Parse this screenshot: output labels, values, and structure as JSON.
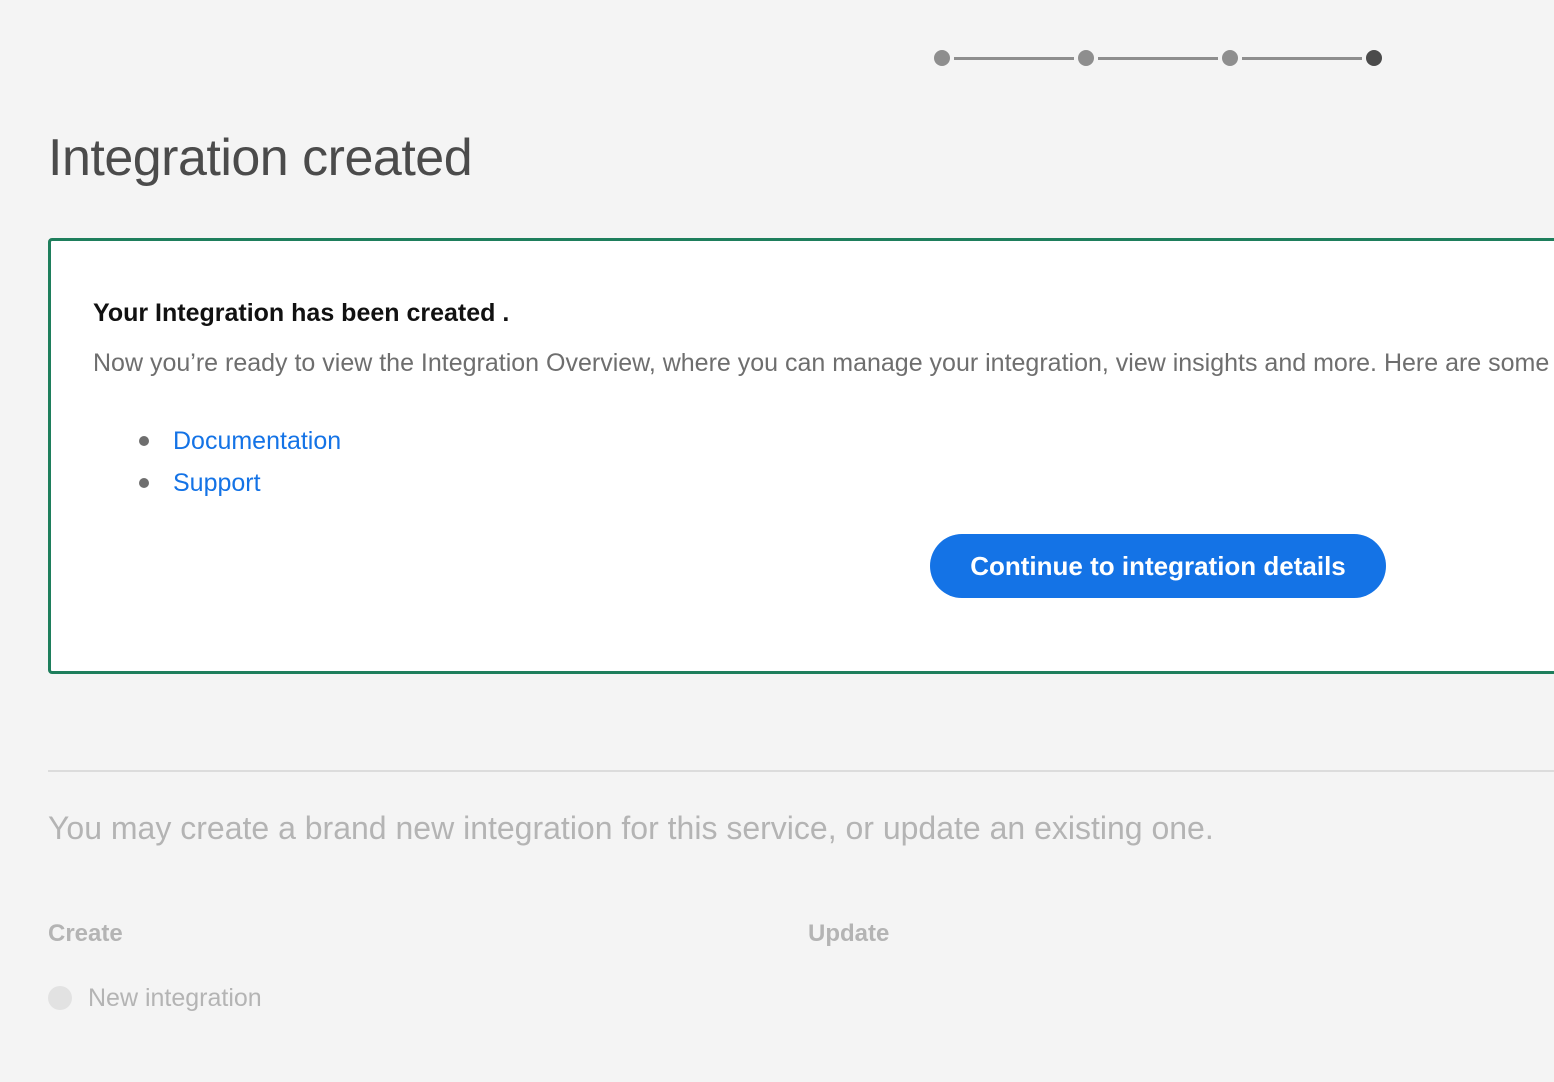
{
  "stepper": {
    "total_steps": 4,
    "current_step": 4
  },
  "header": {
    "title": "Integration created"
  },
  "success_card": {
    "heading": "Your Integration has been created .",
    "body": "Now you’re ready to view the Integration Overview, where you can manage your integration, view insights and more. Here are some",
    "links": [
      {
        "label": "Documentation"
      },
      {
        "label": "Support"
      }
    ],
    "continue_button": "Continue to integration details",
    "border_color": "#1e7e5c"
  },
  "choice_section": {
    "intro": "You may create a brand new integration for this service, or update an existing one.",
    "create_label": "Create",
    "update_label": "Update",
    "new_integration_option": "New integration"
  },
  "colors": {
    "accent": "#1473e6",
    "success": "#1e7e5c",
    "background": "#f4f4f4"
  }
}
